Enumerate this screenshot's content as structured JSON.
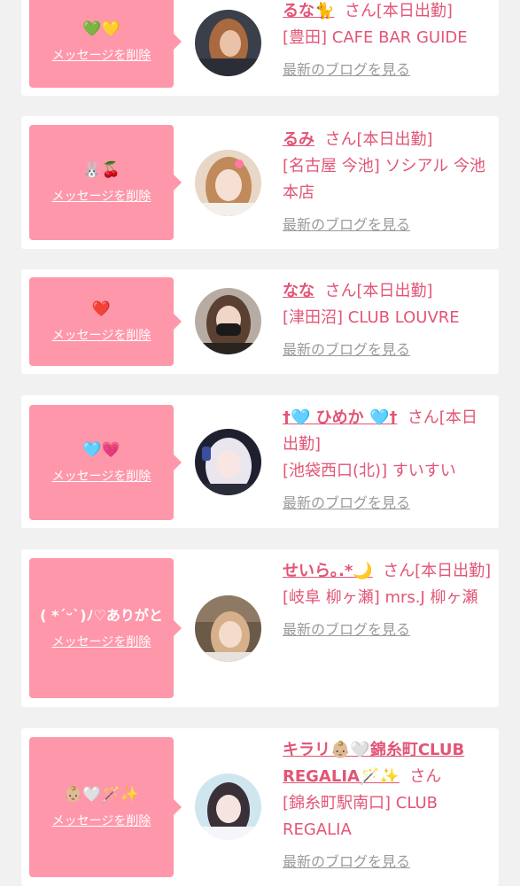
{
  "delete_label": "メッセージを削除",
  "blog_label": "最新のブログを見る",
  "colors": {
    "accent": "#e25576",
    "bubble": "#ff97ab",
    "muted": "#9a9a9a"
  },
  "cards": [
    {
      "message": "💚💛",
      "name": "るな🐈",
      "suffix": "さん[本日出勤]",
      "shop": "[豊田] CAFE BAR GUIDE"
    },
    {
      "message": "🐰🍒",
      "name": "るみ",
      "suffix": "さん[本日出勤]",
      "shop": "[名古屋 今池] ソシアル 今池本店"
    },
    {
      "message": "❤️",
      "name": "なな",
      "suffix": "さん[本日出勤]",
      "shop": "[津田沼] CLUB LOUVRE"
    },
    {
      "message": "🩵💗",
      "name": "†🩵 ひめか 🩵†",
      "suffix": "さん[本日出勤]",
      "shop": "[池袋西口(北)] すいすい"
    },
    {
      "message": "( *ˊᵕˋ)ﾉ♡ありがと",
      "name": "せいら｡.*🌙",
      "suffix": "さん[本日出勤]",
      "shop": "[岐阜 柳ヶ瀬] mrs.J 柳ヶ瀬"
    },
    {
      "message": "👶🏼🤍🪄✨",
      "name": "キラリ👶🏼🤍錦糸町CLUB REGALIA🪄✨",
      "suffix": "さん",
      "shop": "[錦糸町駅南口] CLUB REGALIA"
    }
  ]
}
